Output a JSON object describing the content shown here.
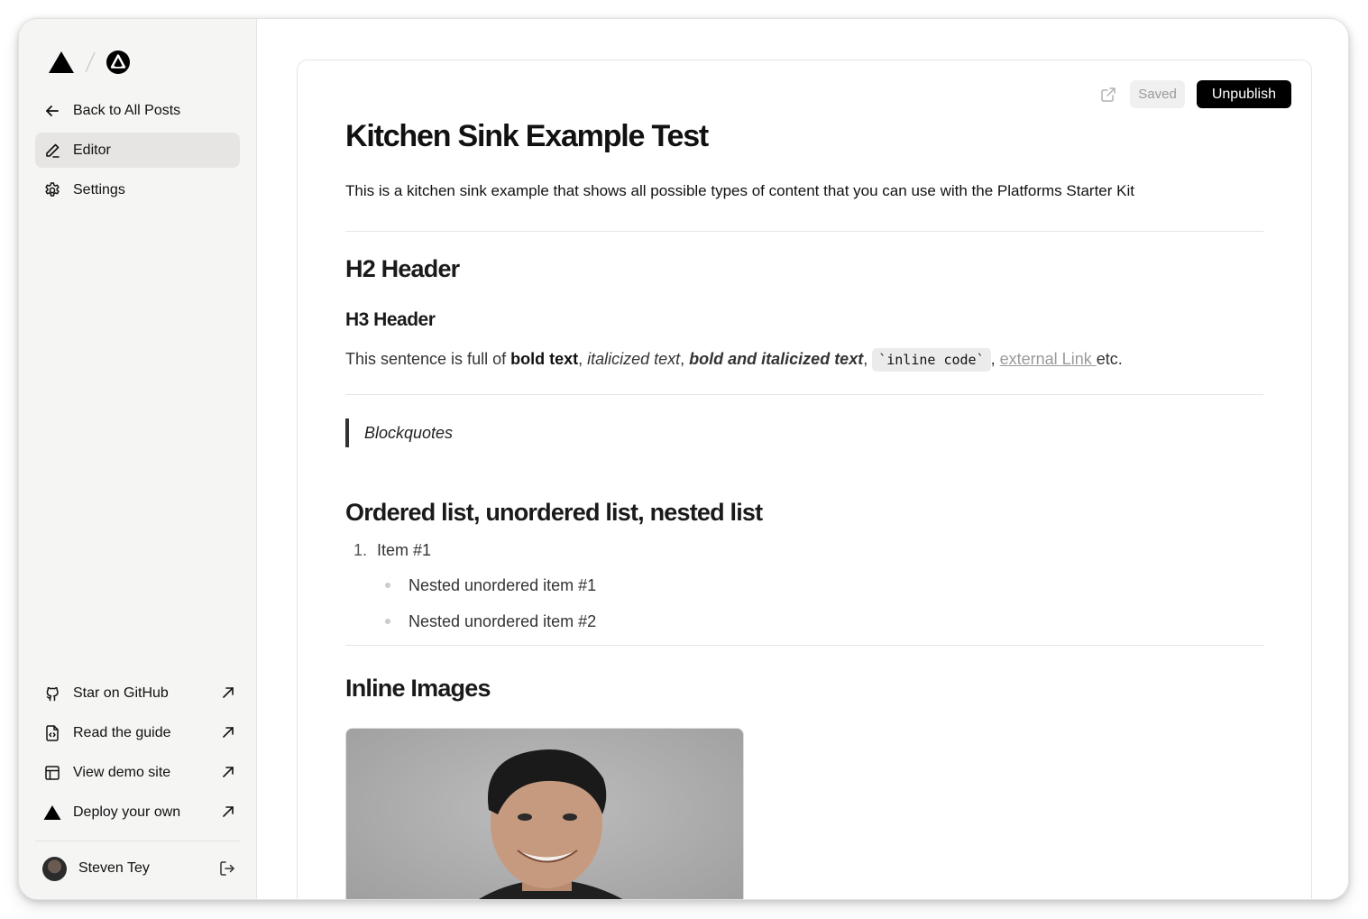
{
  "sidebar": {
    "logo_primary": "vercel-triangle-logo",
    "logo_secondary": "platforms-circle-logo",
    "nav": [
      {
        "label": "Back to All Posts",
        "icon": "arrow-left-icon"
      },
      {
        "label": "Editor",
        "icon": "pen-icon",
        "active": true
      },
      {
        "label": "Settings",
        "icon": "gear-icon"
      }
    ],
    "links": [
      {
        "label": "Star on GitHub",
        "icon": "github-icon"
      },
      {
        "label": "Read the guide",
        "icon": "file-code-icon"
      },
      {
        "label": "View demo site",
        "icon": "layout-icon"
      },
      {
        "label": "Deploy your own",
        "icon": "triangle-icon"
      }
    ],
    "user": {
      "name": "Steven Tey"
    }
  },
  "toolbar": {
    "saved_label": "Saved",
    "unpublish_label": "Unpublish"
  },
  "post": {
    "title": "Kitchen Sink Example Test",
    "description": "This is a kitchen sink example that shows all possible types of content that you can use with the Platforms Starter Kit",
    "h2": "H2 Header",
    "h3": "H3 Header",
    "sentence": {
      "prefix": "This sentence is full of ",
      "bold": "bold text",
      "sep1": ", ",
      "italic": "italicized text",
      "sep2": ", ",
      "bold_italic": "bold and italicized text",
      "sep3": ", ",
      "code": "`inline code`",
      "sep4": ", ",
      "link": "external Link ",
      "suffix": "etc."
    },
    "blockquote": "Blockquotes",
    "lists_heading": "Ordered list, unordered list, nested list",
    "ordered": [
      {
        "num": "1.",
        "label": "Item #1"
      }
    ],
    "nested": [
      "Nested unordered item #1",
      "Nested unordered item #2"
    ],
    "images_heading": "Inline Images"
  },
  "colors": {
    "sidebar_bg": "#f5f5f4",
    "active_bg": "#e7e5e4",
    "button_bg": "#000000",
    "link": "#9a9a9a"
  }
}
